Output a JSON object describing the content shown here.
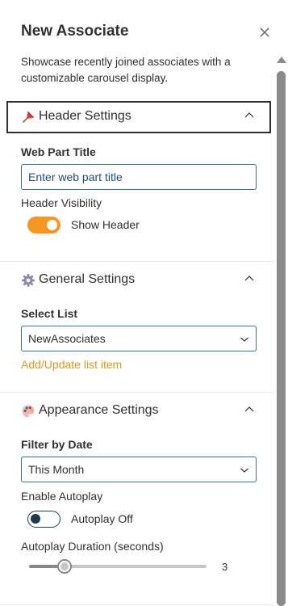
{
  "panel": {
    "title": "New Associate",
    "description": "Showcase recently joined associates with a customizable carousel display."
  },
  "header_settings": {
    "label": "Header Settings",
    "icon": "pushpin-icon",
    "expanded": true,
    "web_part_title_label": "Web Part Title",
    "web_part_title_value": "",
    "web_part_title_placeholder": "Enter web part title",
    "header_visibility_label": "Header Visibility",
    "header_visibility_on": true,
    "header_visibility_text": "Show Header"
  },
  "general_settings": {
    "label": "General Settings",
    "icon": "gear-icon",
    "expanded": true,
    "select_list_label": "Select List",
    "select_list_value": "NewAssociates",
    "add_update_link": "Add/Update list item"
  },
  "appearance_settings": {
    "label": "Appearance Settings",
    "icon": "palette-icon",
    "expanded": true,
    "filter_by_date_label": "Filter by Date",
    "filter_by_date_value": "This Month",
    "enable_autoplay_label": "Enable Autoplay",
    "autoplay_on": false,
    "autoplay_text": "Autoplay Off",
    "autoplay_duration_label": "Autoplay Duration (seconds)",
    "autoplay_duration_value": "3",
    "autoplay_duration_fraction": 0.2
  },
  "colors": {
    "accent_orange": "#f5961e",
    "link_color": "#d99a1e",
    "input_border": "#3c6e8f",
    "text": "#323130"
  }
}
